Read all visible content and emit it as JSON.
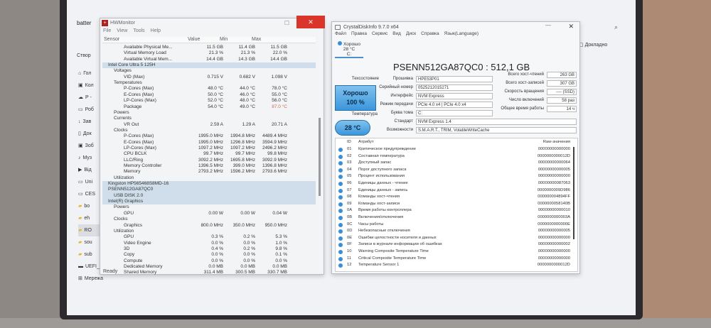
{
  "explorer": {
    "tab": "batter",
    "create": "Створ",
    "details": "Докладно",
    "sidebar": [
      {
        "label": "Гол",
        "icon": "home-icon"
      },
      {
        "label": "Кол",
        "icon": "gallery-icon"
      },
      {
        "label": "P - ",
        "icon": "cloud-icon"
      },
      {
        "label": "Роб",
        "icon": "desktop-icon"
      },
      {
        "label": "Зав",
        "icon": "download-icon"
      },
      {
        "label": "Док",
        "icon": "document-icon"
      },
      {
        "label": "Зоб",
        "icon": "image-icon"
      },
      {
        "label": "Муз",
        "icon": "music-icon"
      },
      {
        "label": "Від",
        "icon": "video-icon"
      },
      {
        "label": "Uni",
        "icon": "drive-icon"
      },
      {
        "label": "CES",
        "icon": "drive-icon"
      },
      {
        "label": "bo",
        "icon": "folder-icon"
      },
      {
        "label": "eh",
        "icon": "folder-icon"
      },
      {
        "label": "RO",
        "icon": "folder-icon"
      },
      {
        "label": "sou",
        "icon": "folder-icon"
      },
      {
        "label": "sub",
        "icon": "folder-icon"
      },
      {
        "label": "UEFI_NTFS (E:)",
        "icon": "usb-drive-icon"
      },
      {
        "label": "Мережа",
        "icon": "network-icon"
      }
    ]
  },
  "hwmonitor": {
    "title": "HWMonitor",
    "menu": [
      "File",
      "View",
      "Tools",
      "Help"
    ],
    "columns": [
      "Sensor",
      "Value",
      "Min",
      "Max"
    ],
    "status": "Ready",
    "rows": [
      {
        "level": 3,
        "name": "Available Physical Me...",
        "value": "11.5 GB",
        "min": "11.4 GB",
        "max": "11.5 GB"
      },
      {
        "level": 3,
        "name": "Virtual Memory Load",
        "value": "21.3 %",
        "min": "21.3 %",
        "max": "22.0 %"
      },
      {
        "level": 3,
        "name": "Available Virtual Mem...",
        "value": "14.4 GB",
        "min": "14.3 GB",
        "max": "14.4 GB"
      },
      {
        "level": 0,
        "name": "Intel Core Ultra 5 125H",
        "value": "",
        "min": "",
        "max": "",
        "hl": true
      },
      {
        "level": 1,
        "name": "Voltages",
        "value": "",
        "min": "",
        "max": ""
      },
      {
        "level": 2,
        "name": "VID (Max)",
        "value": "0.715 V",
        "min": "0.682 V",
        "max": "1.098 V"
      },
      {
        "level": 1,
        "name": "Temperatures",
        "value": "",
        "min": "",
        "max": ""
      },
      {
        "level": 2,
        "name": "P-Cores (Max)",
        "value": "48.0 °C",
        "min": "44.0 °C",
        "max": "78.0 °C"
      },
      {
        "level": 2,
        "name": "E-Cores (Max)",
        "value": "50.0 °C",
        "min": "46.0 °C",
        "max": "55.0 °C"
      },
      {
        "level": 2,
        "name": "LP-Cores (Max)",
        "value": "52.0 °C",
        "min": "48.0 °C",
        "max": "56.0 °C"
      },
      {
        "level": 2,
        "name": "Package",
        "value": "54.0 °C",
        "min": "49.0 °C",
        "max": "87.0 °C",
        "red": true
      },
      {
        "level": 1,
        "name": "Powers",
        "value": "",
        "min": "",
        "max": ""
      },
      {
        "level": 1,
        "name": "Currents",
        "value": "",
        "min": "",
        "max": ""
      },
      {
        "level": 2,
        "name": "VR Out",
        "value": "2.59 A",
        "min": "1.29 A",
        "max": "20.71 A"
      },
      {
        "level": 1,
        "name": "Clocks",
        "value": "",
        "min": "",
        "max": ""
      },
      {
        "level": 2,
        "name": "P-Cores (Max)",
        "value": "1995.0 MHz",
        "min": "1994.8 MHz",
        "max": "4489.4 MHz"
      },
      {
        "level": 2,
        "name": "E-Cores (Max)",
        "value": "1995.0 MHz",
        "min": "1296.8 MHz",
        "max": "3594.9 MHz"
      },
      {
        "level": 2,
        "name": "LP-Cores (Max)",
        "value": "1097.2 MHz",
        "min": "1097.2 MHz",
        "max": "2496.2 MHz"
      },
      {
        "level": 2,
        "name": "CPU BCLK",
        "value": "99.7 MHz",
        "min": "99.7 MHz",
        "max": "99.8 MHz"
      },
      {
        "level": 2,
        "name": "LLC/Ring",
        "value": "3092.2 MHz",
        "min": "1695.8 MHz",
        "max": "3092.9 MHz"
      },
      {
        "level": 2,
        "name": "Memory Controller",
        "value": "1396.5 MHz",
        "min": "399.0 MHz",
        "max": "1396.8 MHz"
      },
      {
        "level": 2,
        "name": "Memory",
        "value": "2793.2 MHz",
        "min": "1596.2 MHz",
        "max": "2793.6 MHz"
      },
      {
        "level": 1,
        "name": "Utilization",
        "value": "",
        "min": "",
        "max": ""
      },
      {
        "level": 0,
        "name": "Kingston HP565468S8MD-16",
        "value": "",
        "min": "",
        "max": "",
        "hl": true
      },
      {
        "level": 0,
        "name": "PSENN512GA87QC0",
        "value": "",
        "min": "",
        "max": "",
        "hl": true
      },
      {
        "level": 1,
        "name": "USB DISK 2.0",
        "value": "",
        "min": "",
        "max": "",
        "hl": true
      },
      {
        "level": 0,
        "name": "Intel(R) Graphics",
        "value": "",
        "min": "",
        "max": "",
        "hl": true
      },
      {
        "level": 1,
        "name": "Powers",
        "value": "",
        "min": "",
        "max": ""
      },
      {
        "level": 2,
        "name": "GPU",
        "value": "0.00 W",
        "min": "0.00 W",
        "max": "0.04 W"
      },
      {
        "level": 1,
        "name": "Clocks",
        "value": "",
        "min": "",
        "max": ""
      },
      {
        "level": 2,
        "name": "Graphics",
        "value": "800.0 MHz",
        "min": "350.0 MHz",
        "max": "950.0 MHz"
      },
      {
        "level": 1,
        "name": "Utilization",
        "value": "",
        "min": "",
        "max": ""
      },
      {
        "level": 2,
        "name": "GPU",
        "value": "0.3 %",
        "min": "0.2 %",
        "max": "5.3 %"
      },
      {
        "level": 2,
        "name": "Video Engine",
        "value": "0.0 %",
        "min": "0.0 %",
        "max": "1.0 %"
      },
      {
        "level": 2,
        "name": "3D",
        "value": "0.4 %",
        "min": "0.2 %",
        "max": "9.8 %"
      },
      {
        "level": 2,
        "name": "Copy",
        "value": "0.0 %",
        "min": "0.0 %",
        "max": "0.1 %"
      },
      {
        "level": 2,
        "name": "Compute",
        "value": "0.0 %",
        "min": "0.0 %",
        "max": "0.0 %"
      },
      {
        "level": 2,
        "name": "Dedicated Memory",
        "value": "0.0 MB",
        "min": "0.0 MB",
        "max": "0.0 MB"
      },
      {
        "level": 2,
        "name": "Shared Memory",
        "value": "311.4 MB",
        "min": "300.5 MB",
        "max": "330.7 MB"
      }
    ]
  },
  "crystaldiskinfo": {
    "title": "CrystalDiskInfo 9.7.0 x64",
    "menu": [
      "Файл",
      "Правка",
      "Сервис",
      "Вид",
      "Диск",
      "Справка",
      "Язык(Language)"
    ],
    "disk_tab": {
      "status": "Хорошо",
      "temp": "28 °C",
      "letter": "C:"
    },
    "model": "PSENN512GA87QC0 : 512,1 GB",
    "health_label": "Техсостояние",
    "health_status": "Хорошо",
    "health_percent": "100 %",
    "temp_label": "Температура",
    "temp_value": "28 °C",
    "left_fields": [
      {
        "label": "Прошивка",
        "value": "HPE53P01"
      },
      {
        "label": "Серийный номер",
        "value": "0525212015271"
      },
      {
        "label": "Интерфейс",
        "value": "NVM Express"
      },
      {
        "label": "Режим передачи",
        "value": "PCIe 4.0 x4 | PCIe 4.0 x4"
      },
      {
        "label": "Буква тома",
        "value": "C:"
      }
    ],
    "wide_fields": [
      {
        "label": "Стандарт",
        "value": "NVM Express 1.4"
      },
      {
        "label": "Возможности",
        "value": "S.M.A.R.T., TRIM, VolatileWriteCache"
      }
    ],
    "right_fields": [
      {
        "label": "Всего хост-чтений",
        "value": "263 GB"
      },
      {
        "label": "Всего хост-записей",
        "value": "307 GB"
      },
      {
        "label": "Скорость вращения",
        "value": "---- (SSD)"
      },
      {
        "label": "Число включений",
        "value": "58 раз"
      },
      {
        "label": "Общее время работы",
        "value": "14 ч"
      }
    ],
    "table_headers": {
      "id": "ID",
      "attr": "Атрибут",
      "raw": "Raw-значения"
    },
    "attributes": [
      {
        "id": "01",
        "name": "Критическое предупреждение",
        "raw": "00000000000000"
      },
      {
        "id": "02",
        "name": "Составная температура",
        "raw": "0000000000012D"
      },
      {
        "id": "03",
        "name": "Доступный запас",
        "raw": "00000000000064"
      },
      {
        "id": "04",
        "name": "Порог доступного запаса",
        "raw": "00000000000005"
      },
      {
        "id": "05",
        "name": "Процент использования",
        "raw": "00000000000000"
      },
      {
        "id": "06",
        "name": "Единицы данных - чтение",
        "raw": "00000000087063"
      },
      {
        "id": "07",
        "name": "Единицы данных - запись",
        "raw": "0000000009D986"
      },
      {
        "id": "08",
        "name": "Команды хост-чтения",
        "raw": "000000004894FF"
      },
      {
        "id": "09",
        "name": "Команды хост-записи",
        "raw": "0000000058140B"
      },
      {
        "id": "0A",
        "name": "Время работы контроллера",
        "raw": "00000000000010"
      },
      {
        "id": "0B",
        "name": "Включения/отключения",
        "raw": "0000000000003A"
      },
      {
        "id": "0C",
        "name": "Часы работы",
        "raw": "0000000000000E"
      },
      {
        "id": "0D",
        "name": "Небезопасные отключения",
        "raw": "00000000000005"
      },
      {
        "id": "0E",
        "name": "Ошибки целостности носителя и данных",
        "raw": "00000000000000"
      },
      {
        "id": "0F",
        "name": "Записи в журнале информации об ошибках",
        "raw": "00000000000002"
      },
      {
        "id": "10",
        "name": "Warning Composite Temperature Time",
        "raw": "00000000000000"
      },
      {
        "id": "11",
        "name": "Critical Composite Temperature Time",
        "raw": "00000000000000"
      },
      {
        "id": "12",
        "name": "Temperature Sensor 1",
        "raw": "0000000000012D"
      }
    ]
  }
}
